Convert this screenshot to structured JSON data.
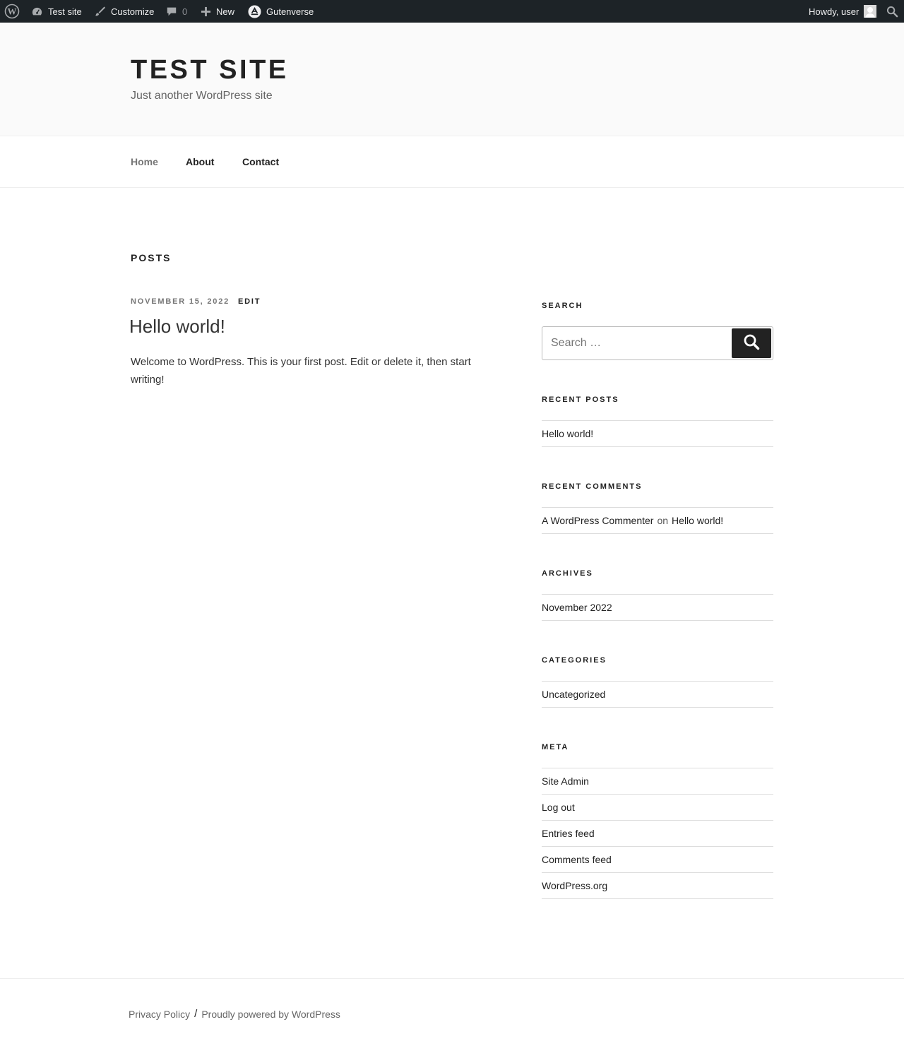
{
  "adminbar": {
    "wp_logo_icon": "wordpress-icon",
    "site_name": "Test site",
    "customize": "Customize",
    "comments_count": "0",
    "new_label": "New",
    "gutenverse": "Gutenverse",
    "howdy": "Howdy, user"
  },
  "header": {
    "title": "Test site",
    "description": "Just another WordPress site"
  },
  "nav": {
    "items": [
      {
        "label": "Home"
      },
      {
        "label": "About"
      },
      {
        "label": "Contact"
      }
    ]
  },
  "main": {
    "heading": "Posts",
    "post": {
      "date": "November 15, 2022",
      "edit": "Edit",
      "title": "Hello world!",
      "excerpt": "Welcome to WordPress. This is your first post. Edit or delete it, then start writing!"
    }
  },
  "sidebar": {
    "search": {
      "title": "Search",
      "placeholder": "Search …",
      "button_icon": "search-icon"
    },
    "recent_posts": {
      "title": "Recent Posts",
      "items": [
        "Hello world!"
      ]
    },
    "recent_comments": {
      "title": "Recent Comments",
      "author": "A WordPress Commenter",
      "on": "on",
      "post": "Hello world!"
    },
    "archives": {
      "title": "Archives",
      "items": [
        "November 2022"
      ]
    },
    "categories": {
      "title": "Categories",
      "items": [
        "Uncategorized"
      ]
    },
    "meta": {
      "title": "Meta",
      "items": [
        "Site Admin",
        "Log out",
        "Entries feed",
        "Comments feed",
        "WordPress.org"
      ]
    }
  },
  "footer": {
    "privacy": "Privacy Policy",
    "separator": "/",
    "powered": "Proudly powered by WordPress"
  }
}
